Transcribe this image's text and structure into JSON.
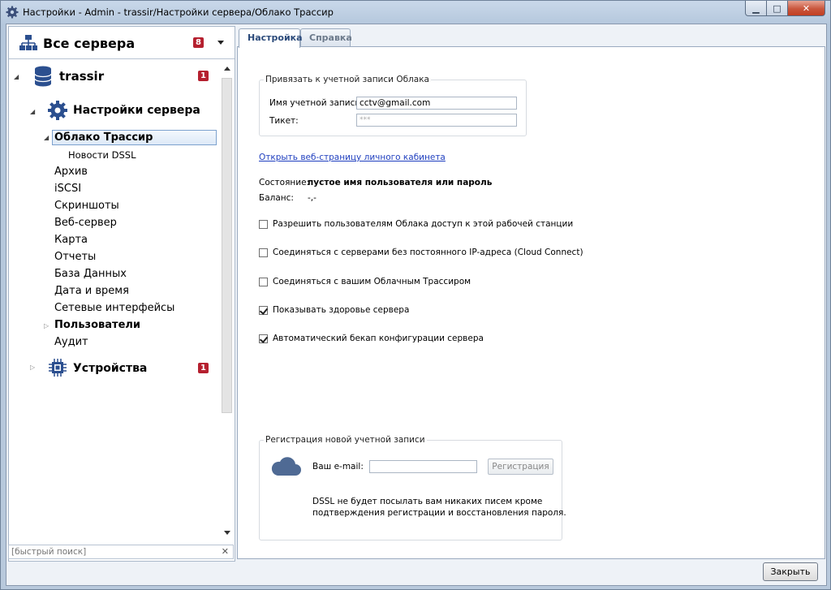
{
  "window": {
    "title": "Настройки - Admin - trassir/Настройки сервера/Облако Трассир"
  },
  "sidebar": {
    "all_servers": {
      "label": "Все сервера",
      "badge": "8"
    },
    "tree": {
      "server": {
        "label": "trassir",
        "badge": "1"
      },
      "settings": {
        "label": "Настройки сервера"
      },
      "cloud": {
        "label": "Облако Трассир"
      },
      "news": {
        "label": "Новости DSSL"
      },
      "items": [
        "Архив",
        "iSCSI",
        "Скриншоты",
        "Веб-сервер",
        "Карта",
        "Отчеты",
        "База Данных",
        "Дата и время",
        "Сетевые интерфейсы",
        "Пользователи",
        "Аудит"
      ],
      "devices": {
        "label": "Устройства",
        "badge": "1"
      }
    },
    "search": {
      "placeholder": "[быстрый поиск]"
    }
  },
  "tabs": [
    {
      "label": "Настройка"
    },
    {
      "label": "Справка"
    }
  ],
  "account": {
    "group_title": "Привязать к учетной записи Облака",
    "username_label": "Имя учетной записи:",
    "username_value": "cctv@gmail.com",
    "ticket_label": "Тикет:",
    "ticket_value": "***"
  },
  "cabinet_link": "Открыть веб-страницу личного кабинета",
  "status": {
    "label": "Состояние:",
    "value": "пустое имя пользователя или пароль"
  },
  "balance": {
    "label": "Баланс:",
    "value": "-,-"
  },
  "options": [
    {
      "label": "Разрешить пользователям Облака доступ к этой рабочей станции",
      "checked": false
    },
    {
      "label": "Соединяться с серверами без постоянного IP-адреса (Cloud Connect)",
      "checked": false
    },
    {
      "label": "Соединяться с вашим Облачным Трассиром",
      "checked": false
    },
    {
      "label": "Показывать здоровье сервера",
      "checked": true
    },
    {
      "label": "Автоматический бекап конфигурации сервера",
      "checked": true
    }
  ],
  "registration": {
    "group_title": "Регистрация новой учетной записи",
    "email_label": "Ваш e-mail:",
    "email_value": "",
    "button": "Регистрация",
    "note_line1": "DSSL не будет посылать вам никаких писем кроме",
    "note_line2": "подтверждения регистрации и восстановления пароля."
  },
  "close_button": "Закрыть",
  "colors": {
    "badge": "#b5202f",
    "link": "#1f3fbf",
    "selection": "#dde9f7"
  }
}
